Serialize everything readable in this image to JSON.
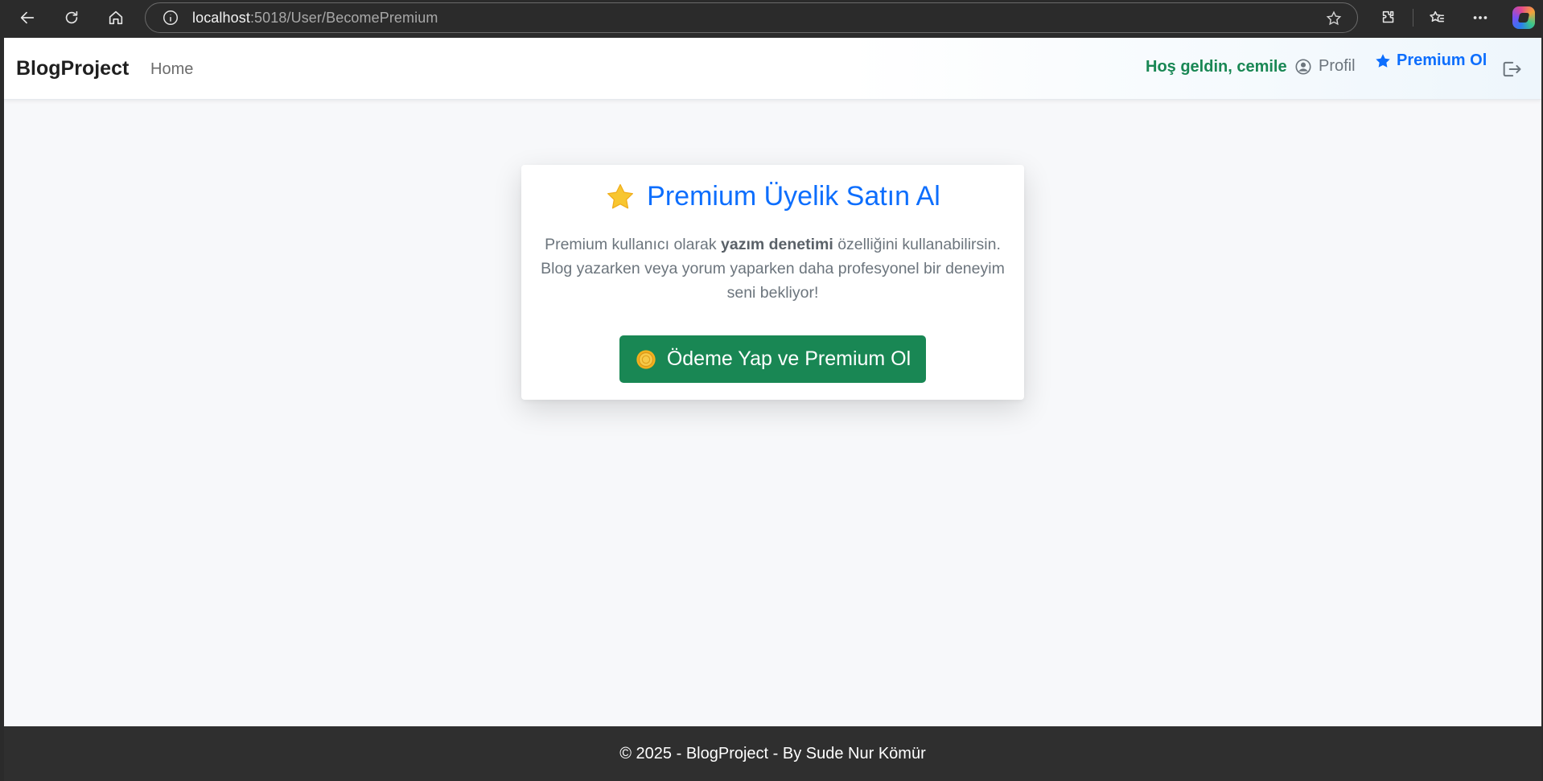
{
  "browser": {
    "url_host": "localhost",
    "url_path": ":5018/User/BecomePremium"
  },
  "navbar": {
    "brand": "BlogProject",
    "home_label": "Home",
    "welcome_text": "Hoş geldin, cemile",
    "profile_label": "Profil",
    "premium_label": "Premium Ol"
  },
  "card": {
    "title": "Premium Üyelik Satın Al",
    "text_before": "Premium kullanıcı olarak ",
    "text_bold": "yazım denetimi",
    "text_after": " özelliğini kullanabilirsin. Blog yazarken veya yorum yaparken daha profesyonel bir deneyim seni bekliyor!",
    "button_label": "Ödeme Yap ve Premium Ol"
  },
  "footer": {
    "text": "© 2025 - BlogProject - By Sude Nur Kömür"
  },
  "colors": {
    "primary": "#0d6efd",
    "success": "#198754",
    "muted": "#6c757d",
    "footer_bg": "#2f2f2f"
  },
  "icons": [
    "back-icon",
    "refresh-icon",
    "home-icon",
    "info-icon",
    "favorite-star-icon",
    "extensions-icon",
    "favorites-icon",
    "more-icon",
    "copilot-icon",
    "user-circle-icon",
    "star-icon",
    "logout-icon",
    "star-emoji-icon",
    "coin-icon"
  ]
}
